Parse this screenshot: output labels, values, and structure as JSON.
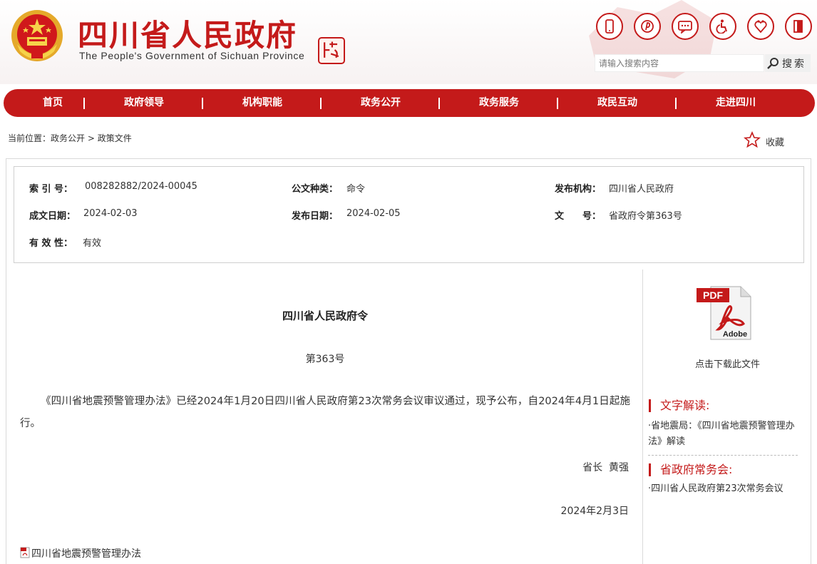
{
  "header": {
    "title": "四川省人民政府",
    "subtitle": "The People's Government of Sichuan Province",
    "search_placeholder": "请输入搜索内容",
    "search_label": "搜索",
    "icons": [
      "mobile-icon",
      "weibo-icon",
      "message-icon",
      "accessibility-icon",
      "elderly-care-icon",
      "exit-icon"
    ]
  },
  "nav": {
    "items": [
      "首页",
      "政府领导",
      "机构职能",
      "政务公开",
      "政务服务",
      "政民互动",
      "走进四川"
    ]
  },
  "breadcrumb": {
    "prefix": "当前位置：",
    "level1": "政务公开",
    "separator": ">",
    "level2": "政策文件"
  },
  "favorite_label": "收藏",
  "meta": {
    "index_label": "索 引 号：",
    "index_value": "008282882/2024-00045",
    "type_label": "公文种类：",
    "type_value": "命令",
    "org_label": "发布机构：",
    "org_value": "四川省人民政府",
    "date_label": "成文日期：",
    "date_value": "2024-02-03",
    "pubdate_label": "发布日期：",
    "pubdate_value": "2024-02-05",
    "docno_label": "文　　号：",
    "docno_value": "省政府令第363号",
    "validity_label": "有 效 性：",
    "validity_value": "有效"
  },
  "article": {
    "title": "四川省人民政府令",
    "number": "第363号",
    "body": "《四川省地震预警管理办法》已经2024年1月20日四川省人民政府第23次常务会议审议通过，现予公布，自2024年4月1日起施行。",
    "signature": "省长  黄强",
    "date": "2024年2月3日",
    "attachment": "四川省地震预警管理办法"
  },
  "sidebar": {
    "download_caption": "点击下载此文件",
    "section1_title": "文字解读:",
    "section1_link": "·省地震局：《四川省地震预警管理办法》解读",
    "section2_title": "省政府常务会:",
    "section2_link": "·四川省人民政府第23次常务会议"
  },
  "colors": {
    "brand_red": "#c41a1a"
  }
}
